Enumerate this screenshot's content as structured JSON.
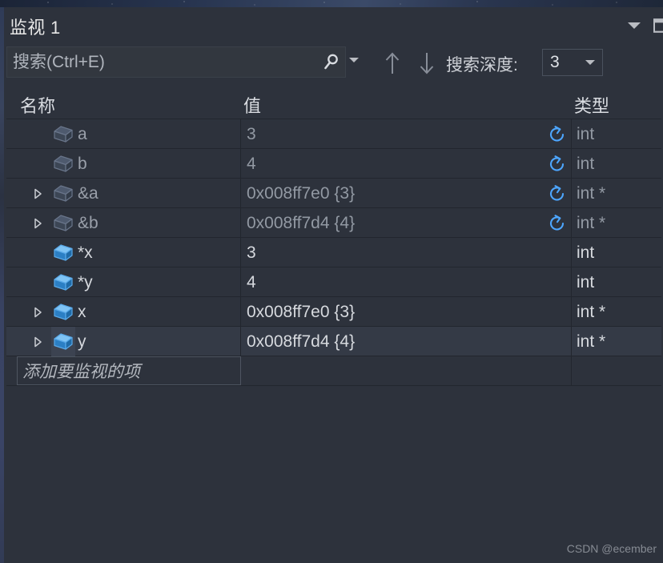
{
  "window": {
    "title": "监视 1",
    "chevron_icon": "chevron-down-icon",
    "dock_icon": "window-dock-icon"
  },
  "toolbar": {
    "search_placeholder": "搜索(Ctrl+E)",
    "search_value": "",
    "search_icon": "search-icon",
    "search_options_icon": "chevron-down-icon",
    "nav_prev_icon": "arrow-up-icon",
    "nav_next_icon": "arrow-down-icon",
    "depth_label": "搜索深度:",
    "depth_value": "3",
    "depth_caret_icon": "chevron-down-icon"
  },
  "grid": {
    "columns": [
      "名称",
      "值",
      "类型"
    ],
    "add_row_label": "添加要监视的项",
    "rows": [
      {
        "name": "a",
        "value": "3",
        "type": "int",
        "expandable": false,
        "refresh": true,
        "stale": true,
        "icon": "variable-cube-icon",
        "icon_active": false,
        "selected": false
      },
      {
        "name": "b",
        "value": "4",
        "type": "int",
        "expandable": false,
        "refresh": true,
        "stale": true,
        "icon": "variable-cube-icon",
        "icon_active": false,
        "selected": false
      },
      {
        "name": "&a",
        "value": "0x008ff7e0 {3}",
        "type": "int *",
        "expandable": true,
        "refresh": true,
        "stale": true,
        "icon": "variable-cube-icon",
        "icon_active": false,
        "selected": false
      },
      {
        "name": "&b",
        "value": "0x008ff7d4 {4}",
        "type": "int *",
        "expandable": true,
        "refresh": true,
        "stale": true,
        "icon": "variable-cube-icon",
        "icon_active": false,
        "selected": false
      },
      {
        "name": "*x",
        "value": "3",
        "type": "int",
        "expandable": false,
        "refresh": false,
        "stale": false,
        "icon": "variable-cube-icon",
        "icon_active": true,
        "selected": false
      },
      {
        "name": "*y",
        "value": "4",
        "type": "int",
        "expandable": false,
        "refresh": false,
        "stale": false,
        "icon": "variable-cube-icon",
        "icon_active": true,
        "selected": false
      },
      {
        "name": "x",
        "value": "0x008ff7e0 {3}",
        "type": "int *",
        "expandable": true,
        "refresh": false,
        "stale": false,
        "icon": "variable-cube-icon",
        "icon_active": true,
        "selected": false
      },
      {
        "name": "y",
        "value": "0x008ff7d4 {4}",
        "type": "int *",
        "expandable": true,
        "refresh": false,
        "stale": false,
        "icon": "variable-cube-icon",
        "icon_active": true,
        "selected": true
      }
    ]
  },
  "watermark": "CSDN @ecember",
  "colors": {
    "pane_bg": "#2d323c",
    "row_selected": "#343a46",
    "grid_line": "#22262e",
    "accent_blue": "#4da6ff",
    "icon_muted": "#5d6a80",
    "text": "#d6d9de",
    "text_muted": "#9299a3"
  }
}
